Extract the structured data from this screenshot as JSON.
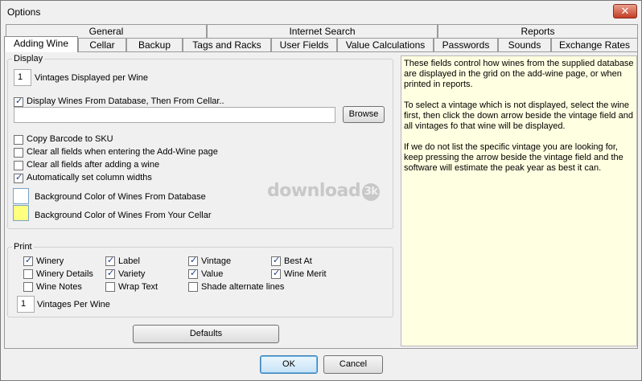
{
  "window": {
    "title": "Options"
  },
  "tabs_row1": [
    "General",
    "Internet Search",
    "Reports"
  ],
  "tabs_row2": [
    "Adding Wine",
    "Cellar",
    "Backup",
    "Tags and Racks",
    "User Fields",
    "Value Calculations",
    "Passwords",
    "Sounds",
    "Exchange Rates"
  ],
  "display": {
    "title": "Display",
    "vintages_value": "1",
    "vintages_label": "Vintages Displayed per Wine",
    "db_then_cellar_label": "Display Wines From Database, Then From Cellar..",
    "browse_label": "Browse",
    "options": [
      {
        "label": "Copy Barcode to SKU",
        "checked": false
      },
      {
        "label": "Clear all fields when entering the Add-Wine page",
        "checked": false
      },
      {
        "label": "Clear all fields after adding a wine",
        "checked": false
      },
      {
        "label": "Automatically set column widths",
        "checked": true
      }
    ],
    "color_db_label": "Background Color of Wines From Database",
    "color_db": "#ffffff",
    "color_cellar_label": "Background Color of Wines From Your Cellar",
    "color_cellar": "#ffff80"
  },
  "watermark": {
    "text": "download",
    "badge": "3k"
  },
  "print": {
    "title": "Print",
    "col1": [
      {
        "label": "Winery",
        "checked": true
      },
      {
        "label": "Winery Details",
        "checked": false
      },
      {
        "label": "Wine Notes",
        "checked": false
      }
    ],
    "col2": [
      {
        "label": "Label",
        "checked": true
      },
      {
        "label": "Variety",
        "checked": true
      },
      {
        "label": "Wrap Text",
        "checked": false
      }
    ],
    "col3": [
      {
        "label": "Vintage",
        "checked": true
      },
      {
        "label": "Value",
        "checked": true
      },
      {
        "label": "Shade alternate lines",
        "checked": false
      }
    ],
    "col4": [
      {
        "label": "Best At",
        "checked": true
      },
      {
        "label": "Wine Merit",
        "checked": true
      }
    ],
    "vintages_value": "1",
    "vintages_label": "Vintages Per Wine"
  },
  "defaults_label": "Defaults",
  "help": {
    "p1": "These fields control how wines from the supplied database are displayed in the grid on the add-wine page, or when printed in reports.",
    "p2": "To select a vintage which is not displayed, select the wine first, then click the down arrow beside the vintage field and all vintages fo that wine will be displayed.",
    "p3": "If we do not list the specific vintage you are looking for, keep pressing the arrow beside the vintage field and the software will estimate the peak year as best it can."
  },
  "ok_label": "OK",
  "cancel_label": "Cancel"
}
